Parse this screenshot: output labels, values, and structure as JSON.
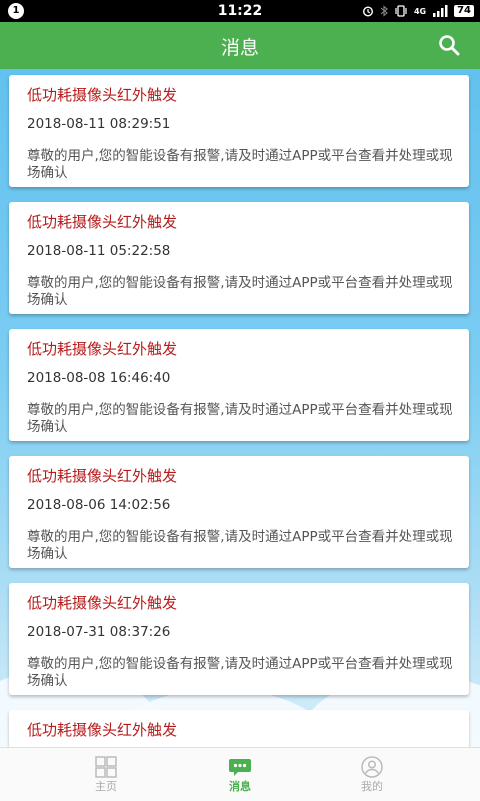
{
  "status_bar": {
    "notification_count": "1",
    "time": "11:22",
    "network_label": "4G",
    "battery": "74"
  },
  "header": {
    "title": "消息"
  },
  "messages": [
    {
      "title": "低功耗摄像头红外触发",
      "time": "2018-08-11 08:29:51",
      "body": "尊敬的用户,您的智能设备有报警,请及时通过APP或平台查看并处理或现场确认"
    },
    {
      "title": "低功耗摄像头红外触发",
      "time": "2018-08-11 05:22:58",
      "body": "尊敬的用户,您的智能设备有报警,请及时通过APP或平台查看并处理或现场确认"
    },
    {
      "title": "低功耗摄像头红外触发",
      "time": "2018-08-08 16:46:40",
      "body": "尊敬的用户,您的智能设备有报警,请及时通过APP或平台查看并处理或现场确认"
    },
    {
      "title": "低功耗摄像头红外触发",
      "time": "2018-08-06 14:02:56",
      "body": "尊敬的用户,您的智能设备有报警,请及时通过APP或平台查看并处理或现场确认"
    },
    {
      "title": "低功耗摄像头红外触发",
      "time": "2018-07-31 08:37:26",
      "body": "尊敬的用户,您的智能设备有报警,请及时通过APP或平台查看并处理或现场确认"
    },
    {
      "title": "低功耗摄像头红外触发",
      "time": "",
      "body": ""
    }
  ],
  "bottom_nav": {
    "items": [
      {
        "label": "主页",
        "icon": "grid-icon",
        "active": false
      },
      {
        "label": "消息",
        "icon": "chat-bubble-icon",
        "active": true
      },
      {
        "label": "我的",
        "icon": "user-icon",
        "active": false
      }
    ]
  },
  "colors": {
    "header_bg": "#4caf50",
    "title_red": "#b71c1c",
    "active_nav": "#4caf50"
  }
}
